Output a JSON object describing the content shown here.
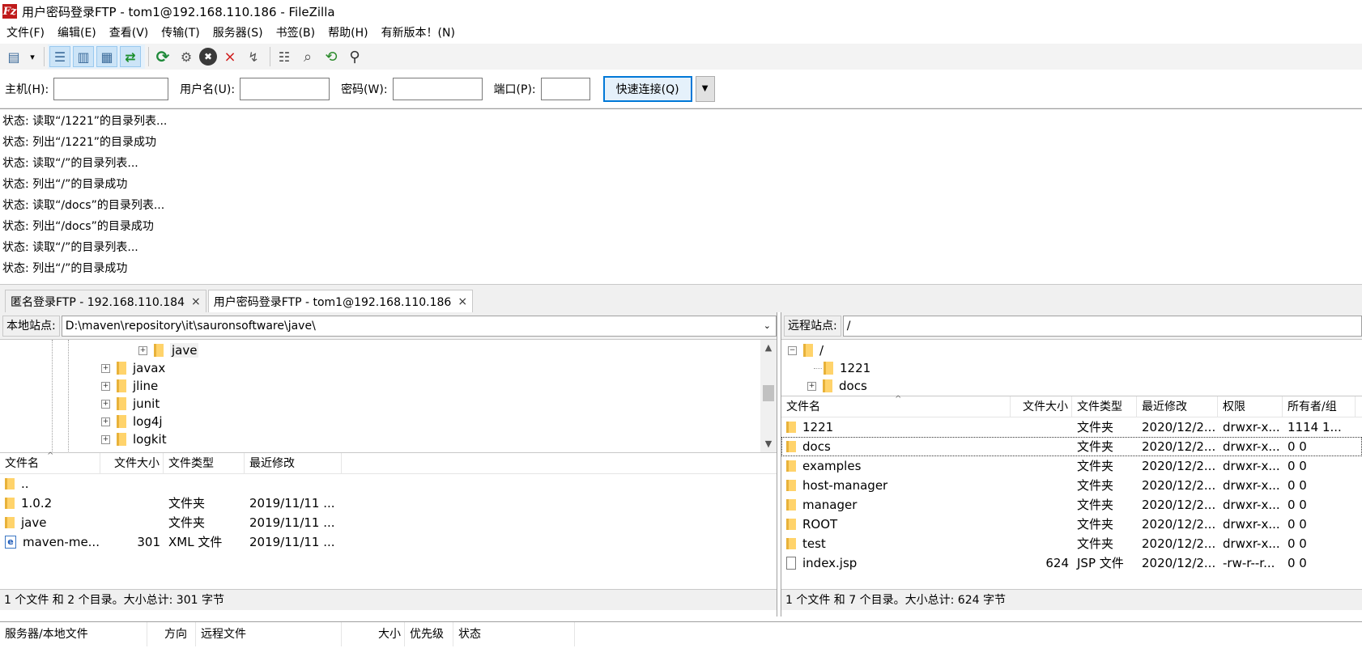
{
  "window": {
    "title": "用户密码登录FTP - tom1@192.168.110.186 - FileZilla",
    "icon": "filezilla-icon",
    "icon_glyph": "Fz"
  },
  "menu": [
    "文件(F)",
    "编辑(E)",
    "查看(V)",
    "传输(T)",
    "服务器(S)",
    "书签(B)",
    "帮助(H)",
    "有新版本！(N)"
  ],
  "toolbar": {
    "buttons": [
      {
        "name": "site-manager",
        "glyph": "▤"
      },
      {
        "name": "dropdown",
        "glyph": "▾"
      },
      {
        "name": "toggle-message-log",
        "glyph": "☰"
      },
      {
        "name": "toggle-local-tree",
        "glyph": "▥"
      },
      {
        "name": "toggle-remote-tree",
        "glyph": "▦"
      },
      {
        "name": "toggle-transfer-queue",
        "glyph": "⇄"
      },
      {
        "name": "refresh",
        "glyph": "⟳"
      },
      {
        "name": "process-queue",
        "glyph": "⚙"
      },
      {
        "name": "cancel",
        "glyph": "✖"
      },
      {
        "name": "disconnect",
        "glyph": "⨯"
      },
      {
        "name": "reconnect",
        "glyph": "↯"
      },
      {
        "name": "directory-listing-filters",
        "glyph": "☷"
      },
      {
        "name": "toggle-sync-browsing",
        "glyph": "⌕"
      },
      {
        "name": "directory-comparison",
        "glyph": "⟲"
      },
      {
        "name": "search-remote-files",
        "glyph": "⚲"
      }
    ]
  },
  "quickconnect": {
    "host_label": "主机(H):",
    "host_value": "",
    "user_label": "用户名(U):",
    "user_value": "",
    "pass_label": "密码(W):",
    "pass_value": "",
    "port_label": "端口(P):",
    "port_value": "",
    "connect_label": "快速连接(Q)",
    "dropdown_glyph": "▼"
  },
  "log": [
    "状态:  读取“/1221”的目录列表...",
    "状态:  列出“/1221”的目录成功",
    "状态:  读取“/”的目录列表...",
    "状态:  列出“/”的目录成功",
    "状态:  读取“/docs”的目录列表...",
    "状态:  列出“/docs”的目录成功",
    "状态:  读取“/”的目录列表...",
    "状态:  列出“/”的目录成功"
  ],
  "tabs": [
    {
      "label": "匿名登录FTP - 192.168.110.184",
      "close": "×",
      "active": false
    },
    {
      "label": "用户密码登录FTP - tom1@192.168.110.186",
      "close": "×",
      "active": true
    }
  ],
  "local": {
    "site_label": "本地站点:",
    "path": "D:\\maven\\repository\\it\\sauronsoftware\\jave\\",
    "tree": [
      {
        "label": "jave",
        "expander": "+"
      },
      {
        "label": "javax",
        "expander": "+"
      },
      {
        "label": "jline",
        "expander": "+"
      },
      {
        "label": "junit",
        "expander": "+"
      },
      {
        "label": "log4j",
        "expander": "+"
      },
      {
        "label": "logkit",
        "expander": "+"
      }
    ],
    "columns": [
      "文件名",
      "文件大小",
      "文件类型",
      "最近修改"
    ],
    "files": [
      {
        "name": "..",
        "size": "",
        "type": "",
        "modified": "",
        "icon": "folder-icon"
      },
      {
        "name": "1.0.2",
        "size": "",
        "type": "文件夹",
        "modified": "2019/11/11 ...",
        "icon": "folder-icon"
      },
      {
        "name": "jave",
        "size": "",
        "type": "文件夹",
        "modified": "2019/11/11 ...",
        "icon": "folder-icon"
      },
      {
        "name": "maven-me...",
        "size": "301",
        "type": "XML 文件",
        "modified": "2019/11/11 ...",
        "icon": "xml-file-icon",
        "icon_glyph": "e"
      }
    ],
    "status": "1 个文件 和 2 个目录。大小总计: 301 字节"
  },
  "remote": {
    "site_label": "远程站点:",
    "path": "/",
    "tree": [
      {
        "label": "/",
        "expander": "−"
      },
      {
        "label": "1221",
        "expander": ""
      },
      {
        "label": "docs",
        "expander": "+"
      }
    ],
    "columns": [
      "文件名",
      "文件大小",
      "文件类型",
      "最近修改",
      "权限",
      "所有者/组"
    ],
    "files": [
      {
        "name": "1221",
        "size": "",
        "type": "文件夹",
        "modified": "2020/12/2...",
        "perm": "drwxr-x...",
        "owner": "1114 1...",
        "icon": "folder-icon"
      },
      {
        "name": "docs",
        "size": "",
        "type": "文件夹",
        "modified": "2020/12/2...",
        "perm": "drwxr-x...",
        "owner": "0 0",
        "icon": "folder-icon"
      },
      {
        "name": "examples",
        "size": "",
        "type": "文件夹",
        "modified": "2020/12/2...",
        "perm": "drwxr-x...",
        "owner": "0 0",
        "icon": "folder-icon"
      },
      {
        "name": "host-manager",
        "size": "",
        "type": "文件夹",
        "modified": "2020/12/2...",
        "perm": "drwxr-x...",
        "owner": "0 0",
        "icon": "folder-icon"
      },
      {
        "name": "manager",
        "size": "",
        "type": "文件夹",
        "modified": "2020/12/2...",
        "perm": "drwxr-x...",
        "owner": "0 0",
        "icon": "folder-icon"
      },
      {
        "name": "ROOT",
        "size": "",
        "type": "文件夹",
        "modified": "2020/12/2...",
        "perm": "drwxr-x...",
        "owner": "0 0",
        "icon": "folder-icon"
      },
      {
        "name": "test",
        "size": "",
        "type": "文件夹",
        "modified": "2020/12/2...",
        "perm": "drwxr-x...",
        "owner": "0 0",
        "icon": "folder-icon"
      },
      {
        "name": "index.jsp",
        "size": "624",
        "type": "JSP 文件",
        "modified": "2020/12/2...",
        "perm": "-rw-r--r...",
        "owner": "0 0",
        "icon": "file-icon"
      }
    ],
    "status": "1 个文件 和 7 个目录。大小总计: 624 字节"
  },
  "queue": {
    "columns": [
      "服务器/本地文件",
      "方向",
      "远程文件",
      "大小",
      "优先级",
      "状态"
    ]
  },
  "glyphs": {
    "scroll_up": "▲",
    "scroll_down": "▼",
    "dropdown": "⌄",
    "sort_caret": "^"
  },
  "colors": {
    "accent": "#0078d7",
    "folder": "#ffd36b",
    "app_icon": "#bf1a1a"
  }
}
